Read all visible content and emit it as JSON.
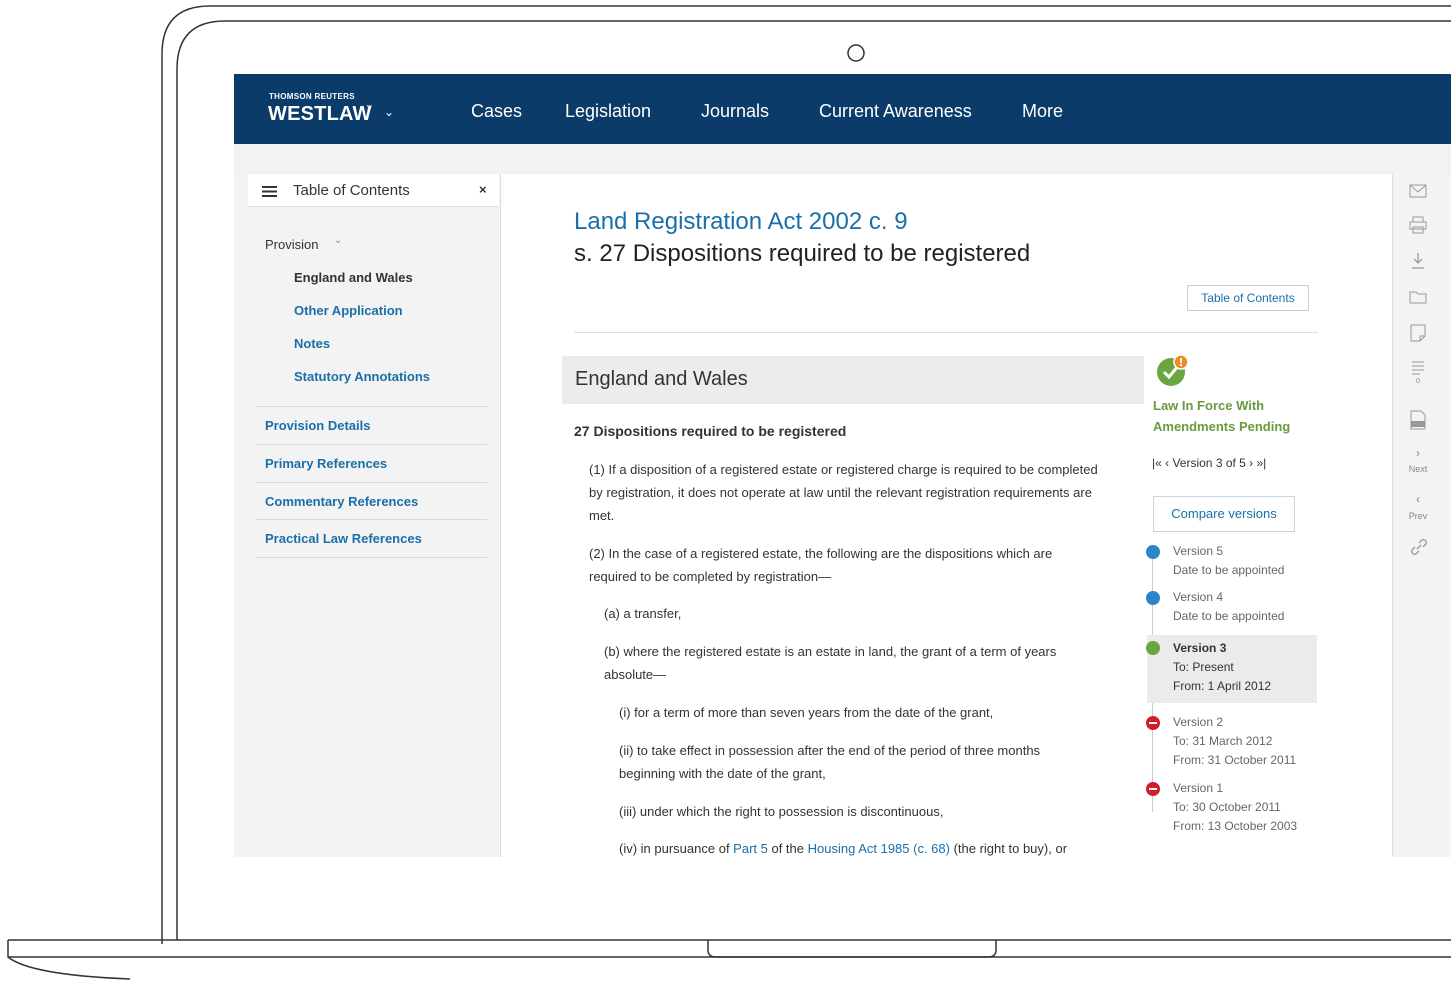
{
  "brand": {
    "top": "THOMSON REUTERS",
    "main": "WESTLAW",
    "tm": "™",
    "chevron": "⌄"
  },
  "nav": [
    "Cases",
    "Legislation",
    "Journals",
    "Current Awareness",
    "More"
  ],
  "toc": {
    "title": "Table of Contents",
    "close": "×",
    "provision": "Provision",
    "provision_chevron": "⌄",
    "items": [
      "England and Wales",
      "Other Application",
      "Notes",
      "Statutory Annotations"
    ],
    "sections": [
      "Provision Details",
      "Primary References",
      "Commentary References",
      "Practical Law References"
    ]
  },
  "doc": {
    "title": "Land Registration Act 2002 c. 9",
    "subtitle": "s. 27 Dispositions required to be registered",
    "toc_button": "Table of Contents",
    "section_heading": "England and Wales",
    "heading": "27 Dispositions required to be registered",
    "p1_a": "(1) If a disposition of a registered estate or registered charge is required to be completed",
    "p1_b": "by registration, it does not operate at law until the relevant registration requirements are",
    "p1_c": "met.",
    "p2_a": "(2) In the case of a registered estate, the following are the dispositions which are",
    "p2_b": "required to be completed by registration—",
    "pa": "(a) a transfer,",
    "pb_a": "(b) where the registered estate is an estate in land, the grant of a term of years",
    "pb_b": "absolute—",
    "pi": "(i) for a term of more than seven years from the date of the grant,",
    "pii_a": "(ii) to take effect in possession after the end of the period of three months",
    "pii_b": "beginning with the date of the grant,",
    "piii": "(iii) under which the right to possession is discontinuous,",
    "piv_pre": "(iv) in pursuance of ",
    "piv_link1": "Part 5",
    "piv_mid": " of the ",
    "piv_link2": "Housing Act 1985 (c. 68)",
    "piv_post": " (the right to buy), or"
  },
  "status": {
    "line1": "Law In Force With",
    "line2": "Amendments Pending",
    "version_nav": "|«  ‹  Version 3 of 5  ›  »|",
    "compare": "Compare versions",
    "versions": [
      {
        "name": "Version 5",
        "l1": "Date to be appointed",
        "l2": "",
        "color": "#2a86c8"
      },
      {
        "name": "Version 4",
        "l1": "Date to be appointed",
        "l2": "",
        "color": "#2a86c8"
      },
      {
        "name": "Version 3",
        "l1": "To: Present",
        "l2": "From: 1 April 2012",
        "color": "#6aa640"
      },
      {
        "name": "Version 2",
        "l1": "To: 31 March 2012",
        "l2": "From: 31 October 2011",
        "color": "#d01f2a"
      },
      {
        "name": "Version 1",
        "l1": "To: 30 October 2011",
        "l2": "From: 13 October 2003",
        "color": "#d01f2a"
      }
    ]
  },
  "tools": {
    "next": "Next",
    "prev": "Prev",
    "pdf": "PDF",
    "count": "0"
  },
  "colors": {
    "nav_bg": "#0b3b68",
    "link": "#1b6fa8",
    "status_green": "#6a9a3e"
  }
}
